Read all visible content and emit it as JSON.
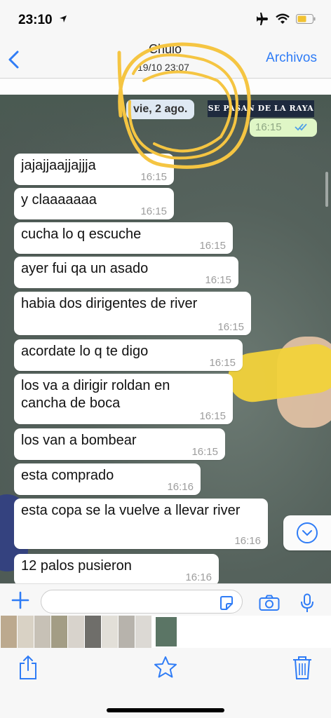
{
  "status_bar": {
    "time": "23:10",
    "battery_color": "#f1c232"
  },
  "nav": {
    "back_icon": "chevron-left-icon",
    "title": "Chuio",
    "subtitle": "19/10 23:07",
    "right_link": "Archivos"
  },
  "chat": {
    "video_caption": "SE PASAN DE LA RAYA",
    "date_pill": "vie, 2 ago.",
    "outgoing_time": "16:15",
    "messages": [
      {
        "text": "jajajjaajjajjja",
        "time": "16:15"
      },
      {
        "text": "y claaaaaaa",
        "time": "16:15"
      },
      {
        "text": "cucha lo q escuche",
        "time": "16:15"
      },
      {
        "text": "ayer fui qa un asado",
        "time": "16:15"
      },
      {
        "text": "habia dos dirigentes de river",
        "time": "16:15"
      },
      {
        "text": "acordate lo q te digo",
        "time": "16:15"
      },
      {
        "text": "los va a dirigir roldan en cancha de boca",
        "time": "16:15"
      },
      {
        "text": "los van a bombear",
        "time": "16:15"
      },
      {
        "text": "esta comprado",
        "time": "16:16"
      },
      {
        "text": "esta copa se la vuelve a llevar river",
        "time": "16:16"
      },
      {
        "text": "12 palos pusieron",
        "time": "16:16"
      }
    ],
    "scroll_icon": "chevron-down-circle-icon"
  },
  "input": {
    "placeholder": "",
    "value": ""
  },
  "toolbar": {
    "share_icon": "share-icon",
    "star_icon": "star-icon",
    "trash_icon": "trash-icon"
  },
  "colors": {
    "accent": "#2f7cf6",
    "annotation": "#f5c542",
    "outgoing_bubble": "#dff6c6"
  }
}
